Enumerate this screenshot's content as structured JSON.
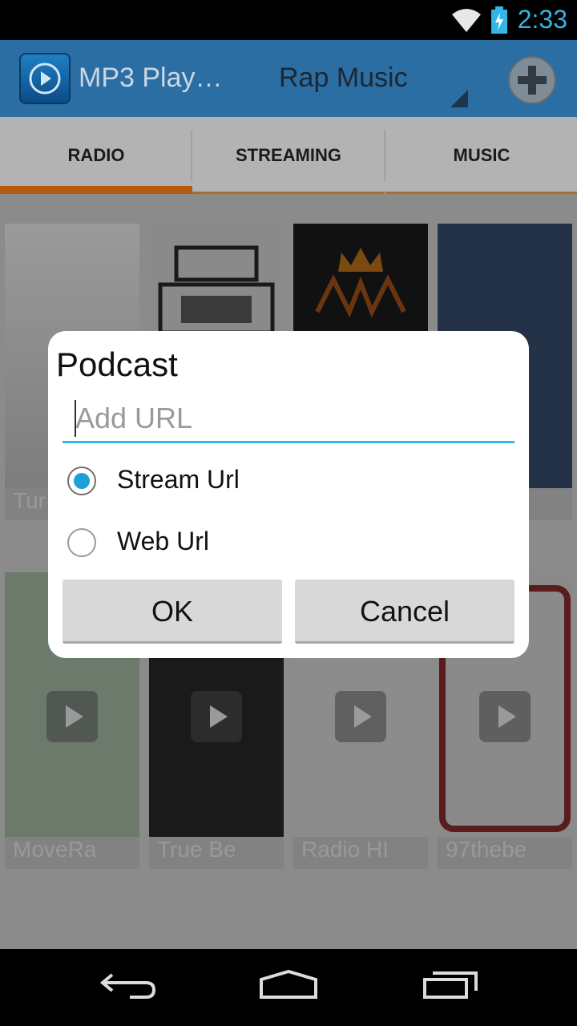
{
  "status_bar": {
    "time": "2:33",
    "wifi_icon": "wifi-icon",
    "battery_icon": "battery-charging-icon",
    "accent": "#33b5e5"
  },
  "action_bar": {
    "app_title": "MP3 Play…",
    "spinner_value": "Rap Music",
    "add_icon": "plus-icon",
    "color": "#2b6ea3"
  },
  "tabs": [
    {
      "label": "RADIO",
      "selected": true
    },
    {
      "label": "STREAMING",
      "selected": false
    },
    {
      "label": "MUSIC",
      "selected": false
    }
  ],
  "cards": [
    {
      "caption": "Tur"
    },
    {
      "caption": ""
    },
    {
      "caption": ""
    },
    {
      "caption": ""
    },
    {
      "caption": "MoveRa"
    },
    {
      "caption": "True Be"
    },
    {
      "caption": "Radio HI"
    },
    {
      "caption": "97thebe"
    }
  ],
  "dialog": {
    "title": "Podcast",
    "url_placeholder": "Add URL",
    "url_value": "",
    "options": [
      {
        "label": "Stream Url",
        "checked": true
      },
      {
        "label": "Web Url",
        "checked": false
      }
    ],
    "ok_label": "OK",
    "cancel_label": "Cancel"
  },
  "nav_bar": {
    "back_icon": "back-icon",
    "home_icon": "home-icon",
    "recents_icon": "recent-apps-icon"
  }
}
